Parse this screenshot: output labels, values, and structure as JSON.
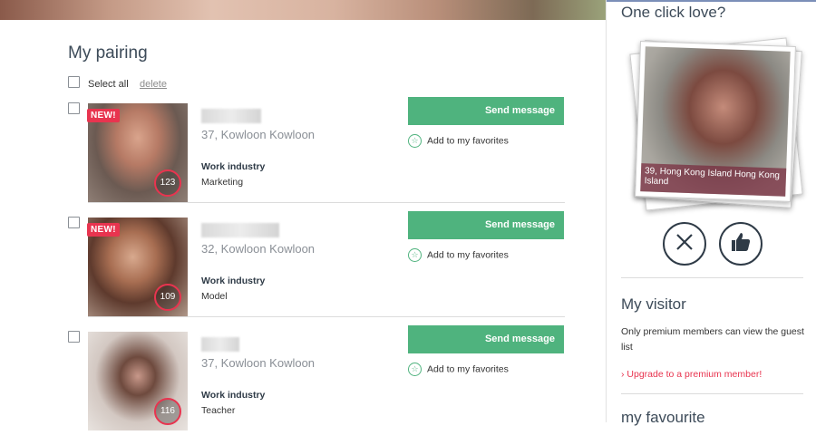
{
  "main": {
    "title": "My pairing",
    "select_all": "Select all",
    "delete": "delete"
  },
  "cards": [
    {
      "badge": "NEW!",
      "score": "123",
      "location": "37, Kowloon Kowloon",
      "industry_label": "Work industry",
      "industry": "Marketing",
      "send_label": "Send message",
      "fav_label": "Add to my favorites"
    },
    {
      "badge": "NEW!",
      "score": "109",
      "location": "32, Kowloon Kowloon",
      "industry_label": "Work industry",
      "industry": "Model",
      "send_label": "Send message",
      "fav_label": "Add to my favorites"
    },
    {
      "badge": "",
      "score": "116",
      "location": "37, Kowloon Kowloon",
      "industry_label": "Work industry",
      "industry": "Teacher",
      "send_label": "Send message",
      "fav_label": "Add to my favorites"
    }
  ],
  "sidebar": {
    "one_click_title": "One click love?",
    "profile_caption": "39, Hong Kong Island Hong Kong Island",
    "visitor_title": "My visitor",
    "visitor_note": "Only premium members can view the guest list",
    "upgrade_link": "Upgrade to a premium member!",
    "favourite_title": "my favourite"
  },
  "colors": {
    "accent_green": "#4fb37e",
    "badge_red": "#e8344f",
    "text_dark": "#3d4b59"
  },
  "icons": [
    "checkbox-icon",
    "star-icon",
    "close-icon",
    "thumbs-up-icon",
    "chevron-right-icon"
  ]
}
